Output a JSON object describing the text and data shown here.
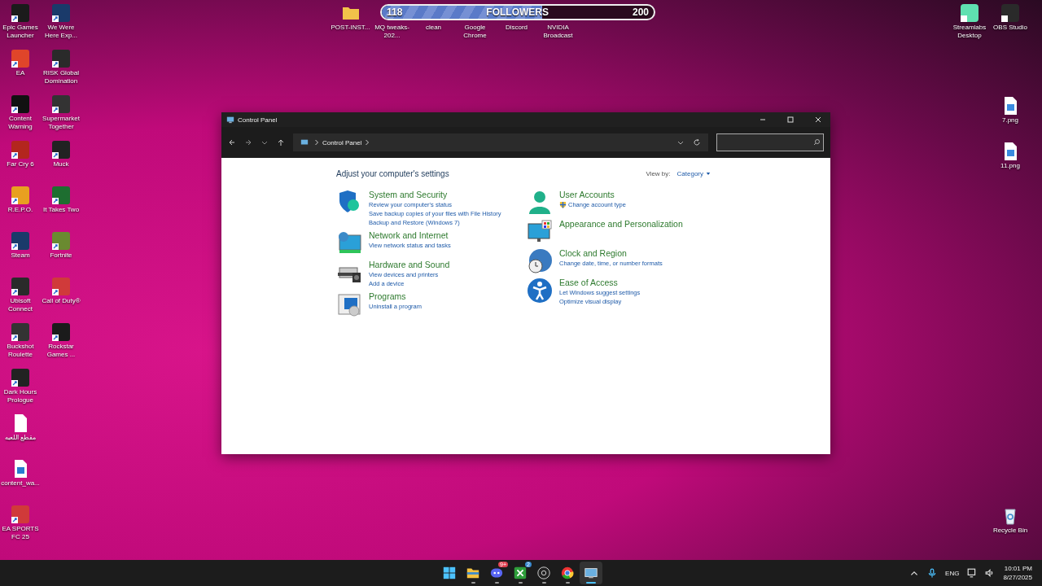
{
  "desktop": {
    "left_icons": [
      {
        "label": "Epic Games Launcher",
        "kind": "shortcut"
      },
      {
        "label": "EA",
        "kind": "shortcut"
      },
      {
        "label": "Content Warning",
        "kind": "shortcut"
      },
      {
        "label": "Far Cry 6",
        "kind": "shortcut"
      },
      {
        "label": "R.E.P.O.",
        "kind": "shortcut"
      },
      {
        "label": "Steam",
        "kind": "shortcut"
      },
      {
        "label": "Ubisoft Connect",
        "kind": "shortcut"
      },
      {
        "label": "Buckshot Roulette",
        "kind": "shortcut"
      },
      {
        "label": "Dark Hours Prologue",
        "kind": "shortcut"
      },
      {
        "label": "مقطع اللعبه",
        "kind": "document"
      },
      {
        "label": "content_wa...",
        "kind": "video"
      },
      {
        "label": "EA SPORTS FC 25",
        "kind": "shortcut"
      }
    ],
    "second_icons": [
      {
        "label": "We Were Here Exp...",
        "kind": "shortcut"
      },
      {
        "label": "RISK Global Domination",
        "kind": "shortcut"
      },
      {
        "label": "Supermarket Together",
        "kind": "shortcut"
      },
      {
        "label": "Muck",
        "kind": "shortcut"
      },
      {
        "label": "It Takes Two",
        "kind": "shortcut"
      },
      {
        "label": "Fortnite",
        "kind": "shortcut"
      },
      {
        "label": "Call of Duty®",
        "kind": "shortcut"
      },
      {
        "label": "Rockstar Games ...",
        "kind": "shortcut"
      }
    ],
    "top_icons": [
      {
        "label": "POST-INST...",
        "kind": "folder"
      },
      {
        "label": "MQ tweaks-202...",
        "kind": "shortcut"
      },
      {
        "label": "clean",
        "kind": "shortcut"
      },
      {
        "label": "Google Chrome",
        "kind": "shortcut"
      },
      {
        "label": "Discord",
        "kind": "shortcut"
      },
      {
        "label": "NVIDIA Broadcast",
        "kind": "shortcut"
      }
    ],
    "right_icons": [
      {
        "label": "Streamlabs Desktop",
        "kind": "shortcut"
      },
      {
        "label": "OBS Studio",
        "kind": "shortcut"
      }
    ],
    "file_icons": [
      {
        "label": "7.png",
        "kind": "image"
      },
      {
        "label": "11.png",
        "kind": "image"
      }
    ],
    "recycle_bin": {
      "label": "Recycle Bin"
    }
  },
  "followers_widget": {
    "current": "118",
    "title": "FOLLOWERS",
    "goal": "200",
    "level": 0.59
  },
  "window": {
    "title": "Control Panel",
    "address": "Control Panel",
    "heading": "Adjust your computer's settings",
    "view_by_label": "View by:",
    "view_by_value": "Category",
    "left_categories": [
      {
        "kind": "system",
        "title": "System and Security",
        "links": [
          {
            "text": "Review your computer's status",
            "shield": false
          },
          {
            "text": "Save backup copies of your files with File History",
            "shield": false
          },
          {
            "text": "Backup and Restore (Windows 7)",
            "shield": false
          }
        ]
      },
      {
        "kind": "network",
        "title": "Network and Internet",
        "links": [
          {
            "text": "View network status and tasks",
            "shield": false
          }
        ]
      },
      {
        "kind": "hardware",
        "title": "Hardware and Sound",
        "links": [
          {
            "text": "View devices and printers",
            "shield": false
          },
          {
            "text": "Add a device",
            "shield": false
          }
        ]
      },
      {
        "kind": "programs",
        "title": "Programs",
        "links": [
          {
            "text": "Uninstall a program",
            "shield": false
          }
        ]
      }
    ],
    "right_categories": [
      {
        "kind": "user",
        "title": "User Accounts",
        "links": [
          {
            "text": "Change account type",
            "shield": true
          }
        ]
      },
      {
        "kind": "appearance",
        "title": "Appearance and Personalization"
      },
      {
        "kind": "clock",
        "title": "Clock and Region",
        "links": [
          {
            "text": "Change date, time, or number formats",
            "shield": false
          }
        ]
      },
      {
        "kind": "access",
        "title": "Ease of Access",
        "links": [
          {
            "text": "Let Windows suggest settings",
            "shield": false
          },
          {
            "text": "Optimize visual display",
            "shield": false
          }
        ]
      }
    ]
  },
  "taskbar": {
    "apps": [
      {
        "kind": "start",
        "running": false,
        "selected": false
      },
      {
        "kind": "explorer",
        "running": true,
        "selected": false
      },
      {
        "kind": "discord",
        "badge": "9+",
        "running": true,
        "selected": false
      },
      {
        "kind": "xbox",
        "badge": "2",
        "running": true,
        "selected": false
      },
      {
        "kind": "obs",
        "running": true,
        "selected": false
      },
      {
        "kind": "chrome",
        "running": true,
        "selected": false
      },
      {
        "kind": "control-panel",
        "running": true,
        "selected": true
      }
    ],
    "language": "ENG",
    "time": "10:01 PM",
    "date": "8/27/2025"
  }
}
